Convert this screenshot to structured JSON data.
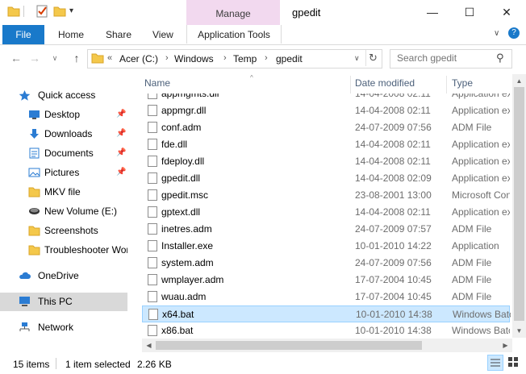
{
  "window": {
    "title": "gpedit",
    "context_tab": "Manage",
    "controls": {
      "minimize": "—",
      "maximize": "☐",
      "close": "✕"
    }
  },
  "ribbon": {
    "file": "File",
    "tabs": [
      "Home",
      "Share",
      "View"
    ],
    "app_tools": "Application Tools"
  },
  "address": {
    "chevron": "«",
    "crumbs": [
      "Acer (C:)",
      "Windows",
      "Temp",
      "gpedit"
    ],
    "separator": "›"
  },
  "search": {
    "placeholder": "Search gpedit"
  },
  "nav": {
    "quick_access": "Quick access",
    "quick_items": [
      {
        "label": "Desktop",
        "pinned": true,
        "icon": "desktop-icon"
      },
      {
        "label": "Downloads",
        "pinned": true,
        "icon": "download-icon"
      },
      {
        "label": "Documents",
        "pinned": true,
        "icon": "documents-icon"
      },
      {
        "label": "Pictures",
        "pinned": true,
        "icon": "pictures-icon"
      },
      {
        "label": "MKV file",
        "pinned": false,
        "icon": "folder-icon"
      },
      {
        "label": "New Volume (E:)",
        "pinned": false,
        "icon": "drive-icon"
      },
      {
        "label": "Screenshots",
        "pinned": false,
        "icon": "folder-icon"
      },
      {
        "label": "Troubleshooter Wor",
        "pinned": false,
        "icon": "folder-icon"
      }
    ],
    "onedrive": "OneDrive",
    "this_pc": "This PC",
    "network": "Network"
  },
  "columns": {
    "name": "Name",
    "date": "Date modified",
    "type": "Type"
  },
  "files": [
    {
      "name": "appmgmts.dll",
      "date": "14-04-2008 02:11",
      "type": "Application ex"
    },
    {
      "name": "appmgr.dll",
      "date": "14-04-2008 02:11",
      "type": "Application ex"
    },
    {
      "name": "conf.adm",
      "date": "24-07-2009 07:56",
      "type": "ADM File"
    },
    {
      "name": "fde.dll",
      "date": "14-04-2008 02:11",
      "type": "Application ex"
    },
    {
      "name": "fdeploy.dll",
      "date": "14-04-2008 02:11",
      "type": "Application ex"
    },
    {
      "name": "gpedit.dll",
      "date": "14-04-2008 02:09",
      "type": "Application ex"
    },
    {
      "name": "gpedit.msc",
      "date": "23-08-2001 13:00",
      "type": "Microsoft Con"
    },
    {
      "name": "gptext.dll",
      "date": "14-04-2008 02:11",
      "type": "Application ex"
    },
    {
      "name": "inetres.adm",
      "date": "24-07-2009 07:57",
      "type": "ADM File"
    },
    {
      "name": "Installer.exe",
      "date": "10-01-2010 14:22",
      "type": "Application"
    },
    {
      "name": "system.adm",
      "date": "24-07-2009 07:56",
      "type": "ADM File"
    },
    {
      "name": "wmplayer.adm",
      "date": "17-07-2004 10:45",
      "type": "ADM File"
    },
    {
      "name": "wuau.adm",
      "date": "17-07-2004 10:45",
      "type": "ADM File"
    },
    {
      "name": "x64.bat",
      "date": "10-01-2010 14:38",
      "type": "Windows Batc",
      "selected": true
    },
    {
      "name": "x86.bat",
      "date": "10-01-2010 14:38",
      "type": "Windows Batc"
    }
  ],
  "status": {
    "items": "15 items",
    "selected": "1 item selected",
    "size": "2.26 KB"
  },
  "colors": {
    "accent": "#1979ca",
    "manage": "#f2d9ef",
    "selection": "#cce8ff"
  }
}
